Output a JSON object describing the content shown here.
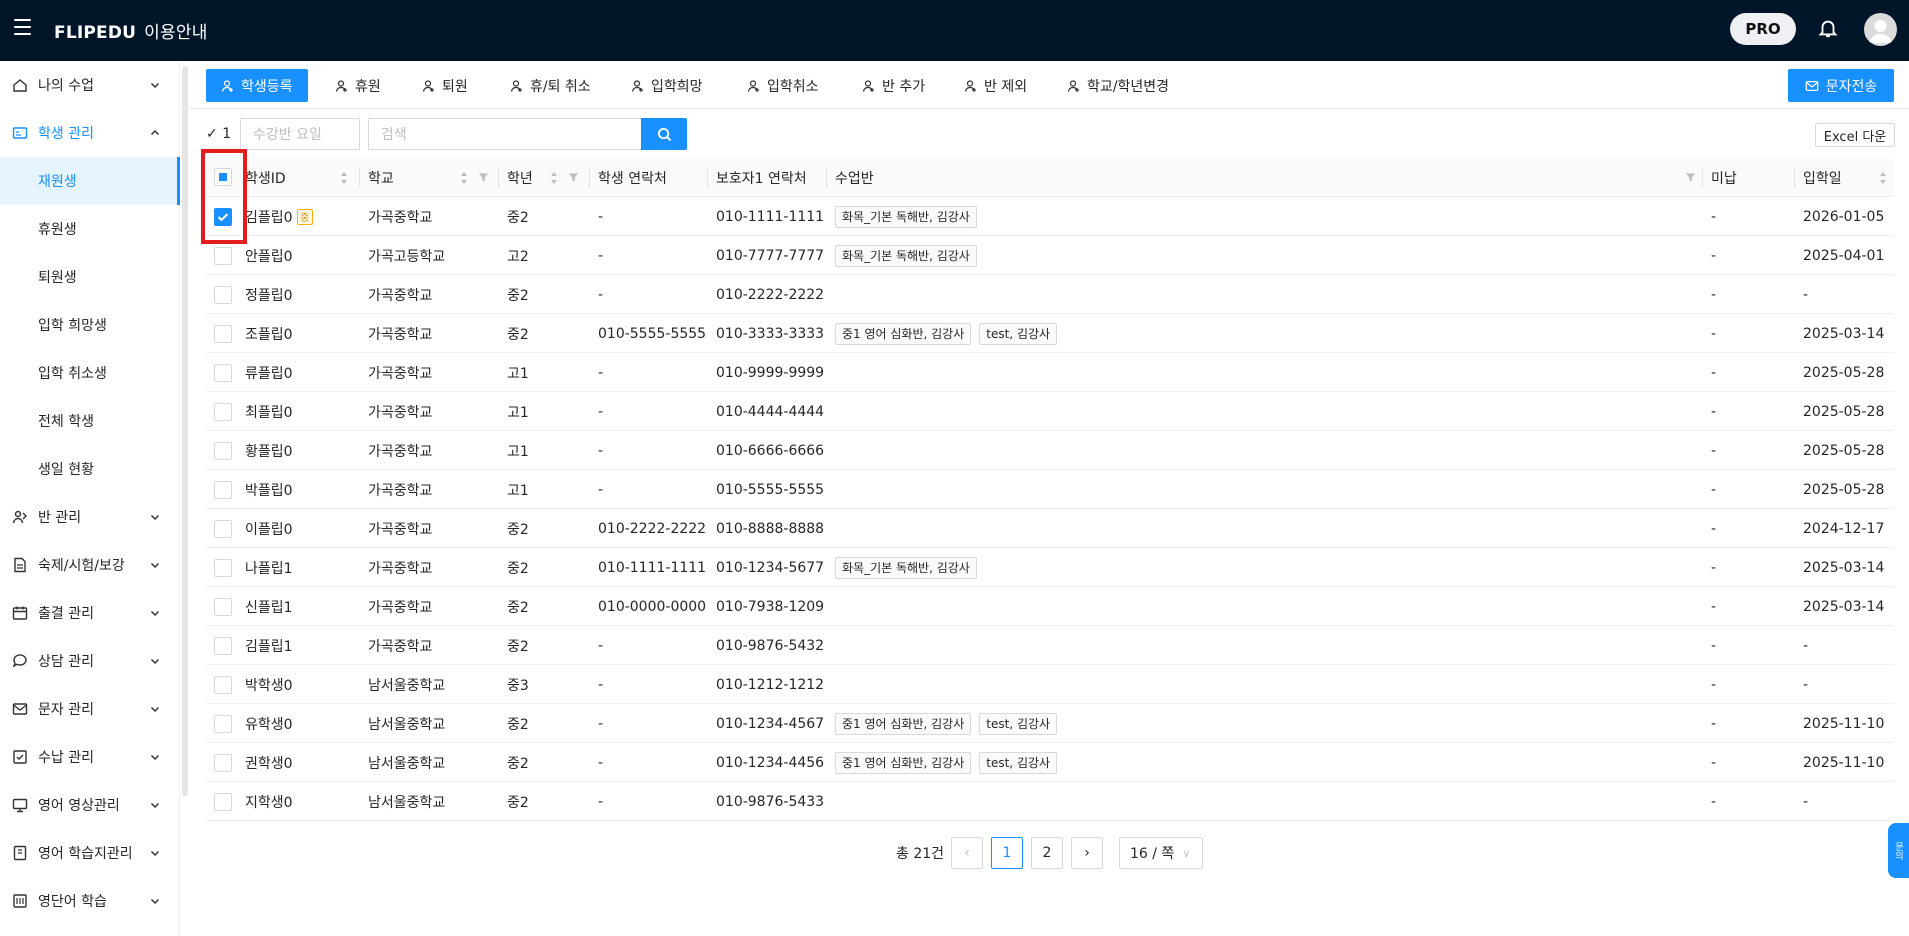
{
  "header": {
    "brand": "FLIPEDU",
    "brand_sub": "이용안내",
    "pro_label": "PRO"
  },
  "sidebar": {
    "menus": [
      {
        "label": "나의 수업",
        "icon": "home-icon"
      },
      {
        "label": "학생 관리",
        "icon": "id-card-icon",
        "expanded": true
      },
      {
        "label": "반 관리",
        "icon": "team-icon"
      },
      {
        "label": "숙제/시험/보강",
        "icon": "file-icon"
      },
      {
        "label": "출결 관리",
        "icon": "calendar-icon"
      },
      {
        "label": "상담 관리",
        "icon": "chat-icon"
      },
      {
        "label": "문자 관리",
        "icon": "mail-icon"
      },
      {
        "label": "수납 관리",
        "icon": "receipt-icon"
      },
      {
        "label": "영어 영상관리",
        "icon": "monitor-icon"
      },
      {
        "label": "영어 학습지관리",
        "icon": "book-icon"
      },
      {
        "label": "영단어 학습",
        "icon": "vocab-icon"
      }
    ],
    "student_sub": [
      "재원생",
      "휴원생",
      "퇴원생",
      "입학 희망생",
      "입학 취소생",
      "전체 학생",
      "생일 현황"
    ]
  },
  "toolbar": {
    "buttons": [
      "학생등록",
      "휴원",
      "퇴원",
      "휴/퇴 취소",
      "입학희망",
      "입학취소",
      "반 추가",
      "반 제외",
      "학교/학년변경"
    ],
    "sms_label": "문자전송"
  },
  "filters": {
    "selected_count": "1",
    "class_day_placeholder": "수강반 요일",
    "search_placeholder": "검색",
    "excel_label": "Excel 다운"
  },
  "table": {
    "columns": [
      "학생ID",
      "학교",
      "학년",
      "학생 연락처",
      "보호자1 연락처",
      "수업반",
      "미납",
      "입학일"
    ],
    "rows": [
      {
        "id": "김플립0",
        "badge": "중",
        "school": "가곡중학교",
        "grade": "중2",
        "phone": "-",
        "guardian": "010-1111-1111",
        "classes": [
          "화목_기본 독해반, 김강사"
        ],
        "unpaid": "-",
        "date": "2026-01-05",
        "checked": true
      },
      {
        "id": "안플립0",
        "school": "가곡고등학교",
        "grade": "고2",
        "phone": "-",
        "guardian": "010-7777-7777",
        "classes": [
          "화목_기본 독해반, 김강사"
        ],
        "unpaid": "-",
        "date": "2025-04-01"
      },
      {
        "id": "정플립0",
        "school": "가곡중학교",
        "grade": "중2",
        "phone": "-",
        "guardian": "010-2222-2222",
        "classes": [],
        "unpaid": "-",
        "date": "-"
      },
      {
        "id": "조플립0",
        "school": "가곡중학교",
        "grade": "중2",
        "phone": "010-5555-5555",
        "guardian": "010-3333-3333",
        "classes": [
          "중1 영어 심화반, 김강사",
          "test, 김강사"
        ],
        "unpaid": "-",
        "date": "2025-03-14"
      },
      {
        "id": "류플립0",
        "school": "가곡중학교",
        "grade": "고1",
        "phone": "-",
        "guardian": "010-9999-9999",
        "classes": [],
        "unpaid": "-",
        "date": "2025-05-28"
      },
      {
        "id": "최플립0",
        "school": "가곡중학교",
        "grade": "고1",
        "phone": "-",
        "guardian": "010-4444-4444",
        "classes": [],
        "unpaid": "-",
        "date": "2025-05-28"
      },
      {
        "id": "황플립0",
        "school": "가곡중학교",
        "grade": "고1",
        "phone": "-",
        "guardian": "010-6666-6666",
        "classes": [],
        "unpaid": "-",
        "date": "2025-05-28"
      },
      {
        "id": "박플립0",
        "school": "가곡중학교",
        "grade": "고1",
        "phone": "-",
        "guardian": "010-5555-5555",
        "classes": [],
        "unpaid": "-",
        "date": "2025-05-28"
      },
      {
        "id": "이플립0",
        "school": "가곡중학교",
        "grade": "중2",
        "phone": "010-2222-2222",
        "guardian": "010-8888-8888",
        "classes": [],
        "unpaid": "-",
        "date": "2024-12-17"
      },
      {
        "id": "나플립1",
        "school": "가곡중학교",
        "grade": "중2",
        "phone": "010-1111-1111",
        "guardian": "010-1234-5677",
        "classes": [
          "화목_기본 독해반, 김강사"
        ],
        "unpaid": "-",
        "date": "2025-03-14"
      },
      {
        "id": "신플립1",
        "school": "가곡중학교",
        "grade": "중2",
        "phone": "010-0000-0000",
        "guardian": "010-7938-1209",
        "classes": [],
        "unpaid": "-",
        "date": "2025-03-14"
      },
      {
        "id": "김플립1",
        "school": "가곡중학교",
        "grade": "중2",
        "phone": "-",
        "guardian": "010-9876-5432",
        "classes": [],
        "unpaid": "-",
        "date": "-"
      },
      {
        "id": "박학생0",
        "school": "남서울중학교",
        "grade": "중3",
        "phone": "-",
        "guardian": "010-1212-1212",
        "classes": [],
        "unpaid": "-",
        "date": "-"
      },
      {
        "id": "유학생0",
        "school": "남서울중학교",
        "grade": "중2",
        "phone": "-",
        "guardian": "010-1234-4567",
        "classes": [
          "중1 영어 심화반, 김강사",
          "test, 김강사"
        ],
        "unpaid": "-",
        "date": "2025-11-10"
      },
      {
        "id": "권학생0",
        "school": "남서울중학교",
        "grade": "중2",
        "phone": "-",
        "guardian": "010-1234-4456",
        "classes": [
          "중1 영어 심화반, 김강사",
          "test, 김강사"
        ],
        "unpaid": "-",
        "date": "2025-11-10"
      },
      {
        "id": "지학생0",
        "school": "남서울중학교",
        "grade": "중2",
        "phone": "-",
        "guardian": "010-9876-5433",
        "classes": [],
        "unpaid": "-",
        "date": "-"
      }
    ]
  },
  "pagination": {
    "total": "총 21건",
    "pages": [
      "1",
      "2"
    ],
    "current": "1",
    "page_size": "16 / 쪽"
  },
  "float_label": "문의",
  "colors": {
    "accent": "#1890ff",
    "topbar": "#011529",
    "highlight": "#e11d1d"
  }
}
